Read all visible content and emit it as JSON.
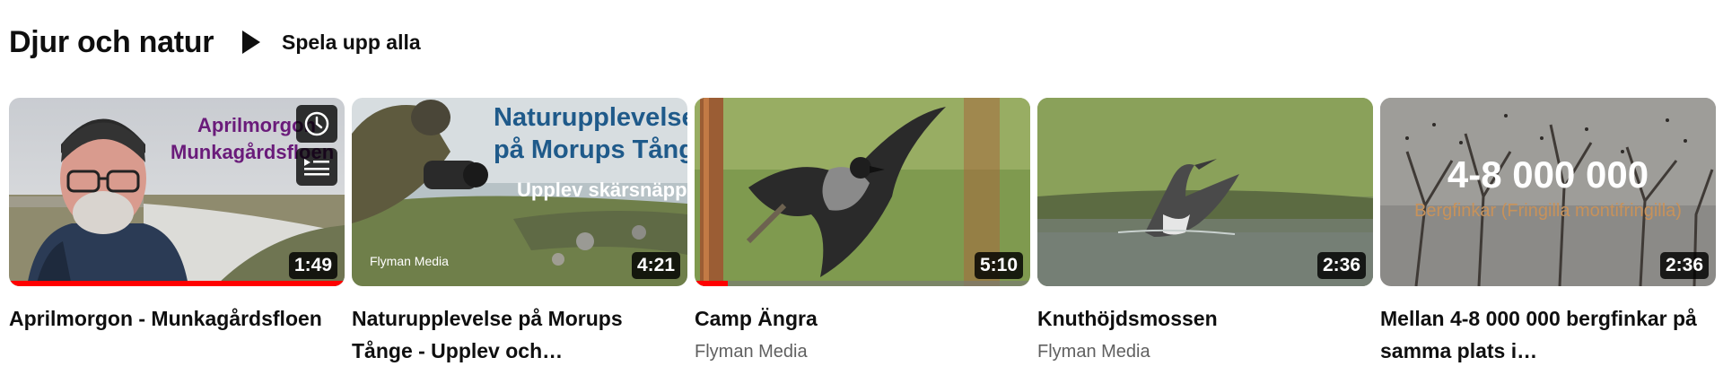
{
  "shelf": {
    "title": "Djur och natur",
    "play_all_label": "Spela upp alla"
  },
  "videos": [
    {
      "title": "Aprilmorgon - Munkagårdsfloen",
      "duration": "1:49",
      "channel": "",
      "watched_fraction": 1.0,
      "thumb_text": [
        "Aprilmorgon",
        "Munkagårdsfloen"
      ],
      "thumb_text_color": "#6a1b7a",
      "hover_icons": [
        "clock-icon",
        "add-to-queue-icon"
      ]
    },
    {
      "title": "Naturupplevelse på Morups Tånge - Upplev och…",
      "duration": "4:21",
      "channel": "",
      "watched_fraction": 0,
      "thumb_text": [
        "Naturupplevelse",
        "på Morups Tånge",
        "Upplev skärsnäppor"
      ],
      "thumb_logo": "Flyman Media",
      "thumb_text_color": "#1f5a8a"
    },
    {
      "title": "Camp Ängra",
      "duration": "5:10",
      "channel": "Flyman Media",
      "watched_fraction": 0.1
    },
    {
      "title": "Knuthöjdsmossen",
      "duration": "2:36",
      "channel": "Flyman Media",
      "watched_fraction": 0
    },
    {
      "title": "Mellan 4-8 000 000 bergfinkar på samma plats i…",
      "duration": "2:36",
      "channel": "",
      "watched_fraction": 0,
      "thumb_text": [
        "4-8 000 000",
        "Bergfinkar (Fringilla montifringilla)"
      ],
      "thumb_subtext_color": "#c8925a"
    }
  ],
  "colors": {
    "progress_red": "#ff0000",
    "channel_gray": "#606060"
  }
}
